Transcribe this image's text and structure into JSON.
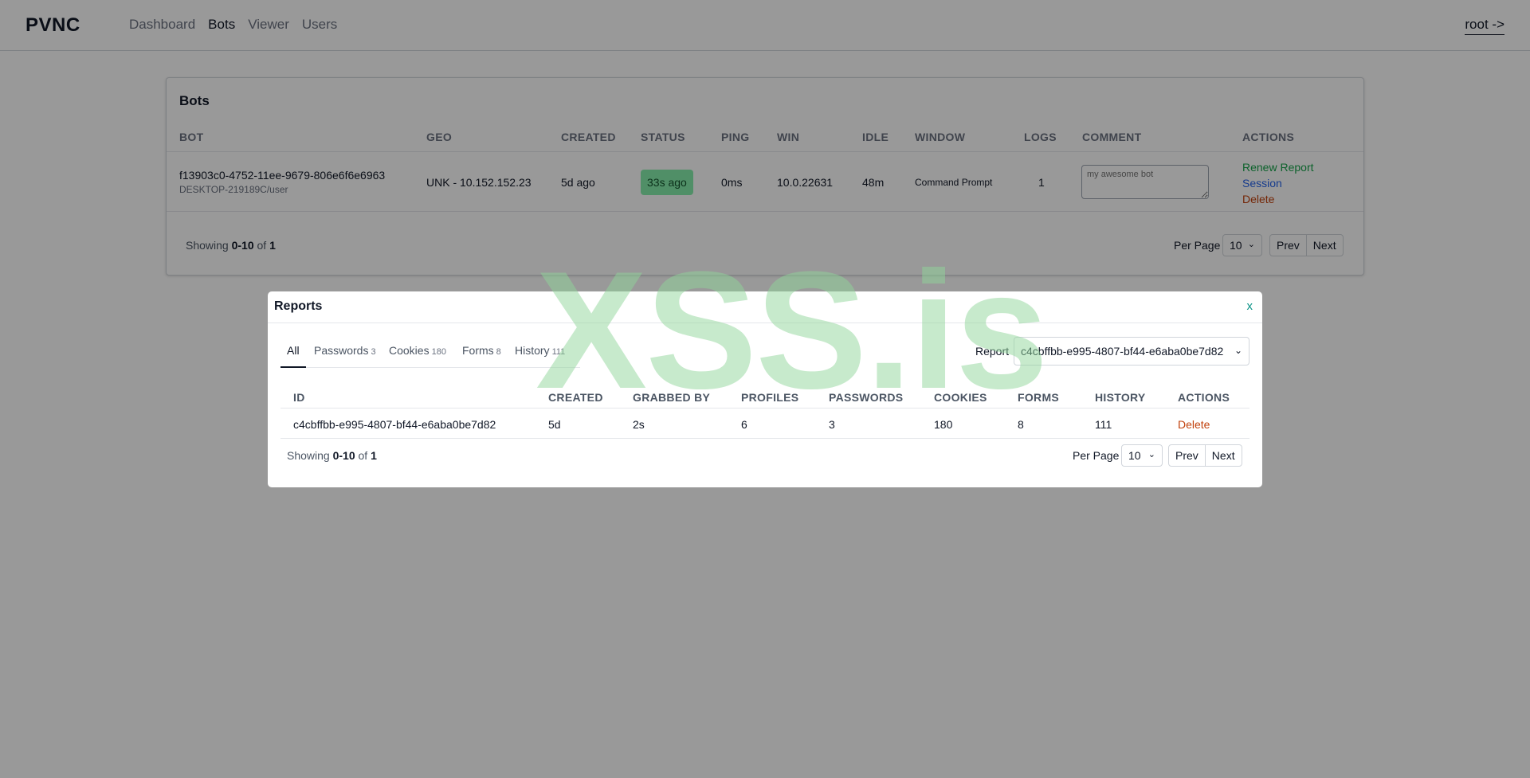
{
  "nav": {
    "brand": "PVNC",
    "links": [
      {
        "label": "Dashboard"
      },
      {
        "label": "Bots"
      },
      {
        "label": "Viewer"
      },
      {
        "label": "Users"
      }
    ],
    "user": "root ->"
  },
  "bots": {
    "title": "Bots",
    "columns": [
      "BOT",
      "GEO",
      "CREATED",
      "STATUS",
      "PING",
      "WIN",
      "IDLE",
      "WINDOW",
      "LOGS",
      "COMMENT",
      "ACTIONS"
    ],
    "row": {
      "id": "f13903c0-4752-11ee-9679-806e6f6e6963",
      "machine": "DESKTOP-219189C/user",
      "geo": "UNK - 10.152.152.23",
      "created": "5d ago",
      "status": "33s ago",
      "ping": "0ms",
      "win": "10.0.22631",
      "idle": "48m",
      "window": "Command Prompt",
      "logs": "1",
      "comment_placeholder": "my awesome bot",
      "actions": {
        "renew": "Renew Report",
        "session": "Session",
        "delete": "Delete"
      }
    },
    "footer": {
      "showing_prefix": "Showing",
      "showing_range": "0-10",
      "showing_of": "of",
      "showing_total": "1",
      "per_page_label": "Per Page",
      "per_page_value": "10",
      "prev": "Prev",
      "next": "Next"
    }
  },
  "reports": {
    "title": "Reports",
    "close": "x",
    "tabs": [
      {
        "label": "All",
        "count": ""
      },
      {
        "label": "Passwords",
        "count": "3"
      },
      {
        "label": "Cookies",
        "count": "180"
      },
      {
        "label": "Forms",
        "count": "8"
      },
      {
        "label": "History",
        "count": "111"
      }
    ],
    "report_label": "Report",
    "report_value": "c4cbffbb-e995-4807-bf44-e6aba0be7d82",
    "columns": [
      "ID",
      "CREATED",
      "GRABBED BY",
      "PROFILES",
      "PASSWORDS",
      "COOKIES",
      "FORMS",
      "HISTORY",
      "ACTIONS"
    ],
    "row": {
      "id": "c4cbffbb-e995-4807-bf44-e6aba0be7d82",
      "created": "5d",
      "grabbed_by": "2s",
      "profiles": "6",
      "passwords": "3",
      "cookies": "180",
      "forms": "8",
      "history": "111",
      "action": "Delete"
    },
    "footer": {
      "showing_prefix": "Showing",
      "showing_range": "0-10",
      "showing_of": "of",
      "showing_total": "1",
      "per_page_label": "Per Page",
      "per_page_value": "10",
      "prev": "Prev",
      "next": "Next"
    }
  },
  "watermark": "XSS.is",
  "colors": {
    "status_badge": "#86efac",
    "renew": "#16a34a",
    "session": "#2563eb",
    "delete": "#c2410c",
    "close": "#0d9488"
  }
}
